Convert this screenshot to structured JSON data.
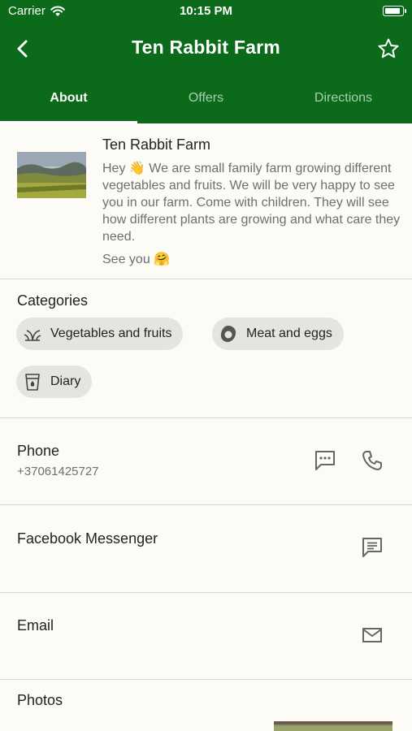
{
  "status": {
    "carrier": "Carrier",
    "time": "10:15 PM"
  },
  "nav": {
    "title": "Ten Rabbit Farm",
    "back_icon": "chevron-left-icon",
    "favorite_icon": "star-outline-icon"
  },
  "tabs": [
    {
      "label": "About",
      "active": true
    },
    {
      "label": "Offers",
      "active": false
    },
    {
      "label": "Directions",
      "active": false
    }
  ],
  "about": {
    "name": "Ten Rabbit Farm",
    "description": "Hey 👋  We are small family farm growing different vegetables and fruits. We will be very happy to see you in our farm. Come with children. They will see how different plants are growing and what care they need.",
    "see_you": "See you 🤗"
  },
  "categories": {
    "title": "Categories",
    "items": [
      {
        "label": "Vegetables and fruits",
        "icon": "sprout-icon"
      },
      {
        "label": "Meat and eggs",
        "icon": "egg-icon"
      },
      {
        "label": "Diary",
        "icon": "milk-icon"
      }
    ]
  },
  "contacts": {
    "phone": {
      "label": "Phone",
      "value": "+37061425727"
    },
    "messenger": {
      "label": "Facebook Messenger"
    },
    "email": {
      "label": "Email"
    }
  },
  "photos": {
    "title": "Photos"
  },
  "colors": {
    "header": "#0b6b1a",
    "background": "#fcfbf5",
    "chip": "#e5e5df",
    "muted_text": "#6f6f6f"
  }
}
